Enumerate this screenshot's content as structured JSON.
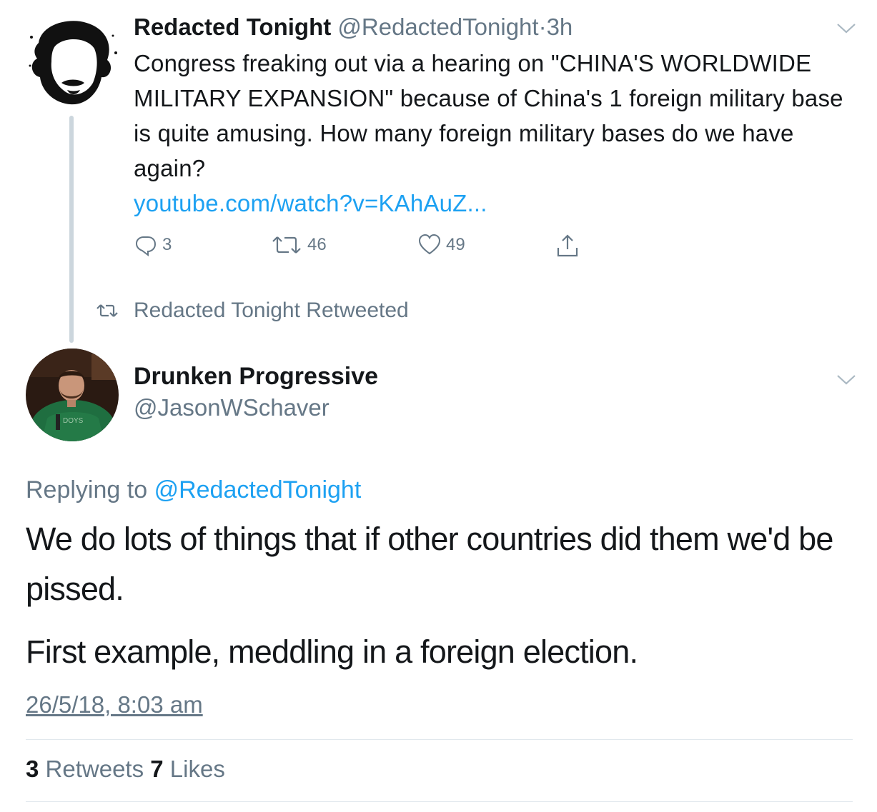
{
  "parent_tweet": {
    "display_name": "Redacted Tonight",
    "handle": "@RedactedTonight",
    "separator": "·",
    "time_ago": "3h",
    "text": "Congress freaking out via a hearing on \"CHINA'S WORLDWIDE MILITARY EXPANSION\" because of China's 1 foreign military base is quite amusing. How many foreign military bases do we have again?",
    "link": "youtube.com/watch?v=KAhAuZ...",
    "reply_count": "3",
    "retweet_count": "46",
    "like_count": "49",
    "icons": [
      "reply-icon",
      "retweet-icon",
      "like-icon",
      "share-icon",
      "chevron-down-icon"
    ]
  },
  "retweet_context": {
    "label": "Redacted Tonight Retweeted",
    "icon": "retweet-icon"
  },
  "main_tweet": {
    "display_name": "Drunken Progressive",
    "handle": "@JasonWSchaver",
    "replying_prefix": "Replying to",
    "replying_mention": "@RedactedTonight",
    "paragraph1": "We do lots of things that if other countries did them we'd be pissed.",
    "paragraph2": "First example, meddling in a foreign election.",
    "timestamp": "26/5/18, 8:03 am",
    "retweets_count": "3",
    "retweets_label": "Retweets",
    "likes_count": "7",
    "likes_label": "Likes"
  },
  "colors": {
    "link_blue": "#1da1f2",
    "meta_gray": "#657786",
    "text_dark": "#14171a",
    "thread_line": "#ccd6dd",
    "divider": "#e1e8ed"
  }
}
